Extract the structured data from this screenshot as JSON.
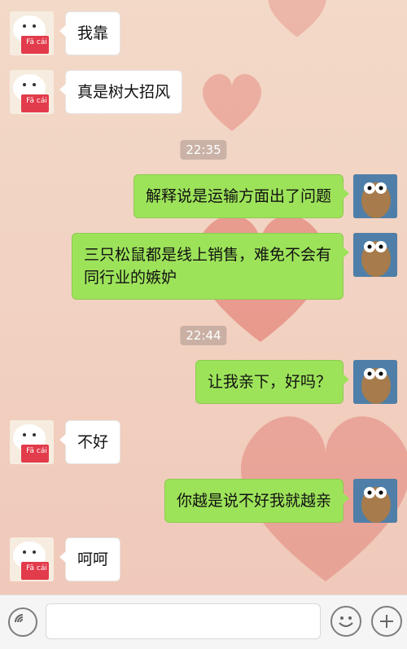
{
  "messages": [
    {
      "side": "left",
      "text": "我靠"
    },
    {
      "side": "left",
      "text": "真是树大招风"
    },
    {
      "time": "22:35"
    },
    {
      "side": "right",
      "text": "解释说是运输方面出了问题"
    },
    {
      "side": "right",
      "text": "三只松鼠都是线上销售，难免不会有同行业的嫉妒"
    },
    {
      "time": "22:44"
    },
    {
      "side": "right",
      "text": "让我亲下，好吗？"
    },
    {
      "side": "left",
      "text": "不好"
    },
    {
      "side": "right",
      "text": "你越是说不好我就越亲"
    },
    {
      "side": "left",
      "text": "呵呵"
    }
  ],
  "avatar_left_text": "Fā cái",
  "colors": {
    "bubble_right": "#9de35a",
    "bubble_left": "#ffffff",
    "timestamp_bg": "#aa968c"
  },
  "icons": {
    "voice": "voice-icon",
    "emoji": "emoji-icon",
    "add": "add-icon"
  }
}
